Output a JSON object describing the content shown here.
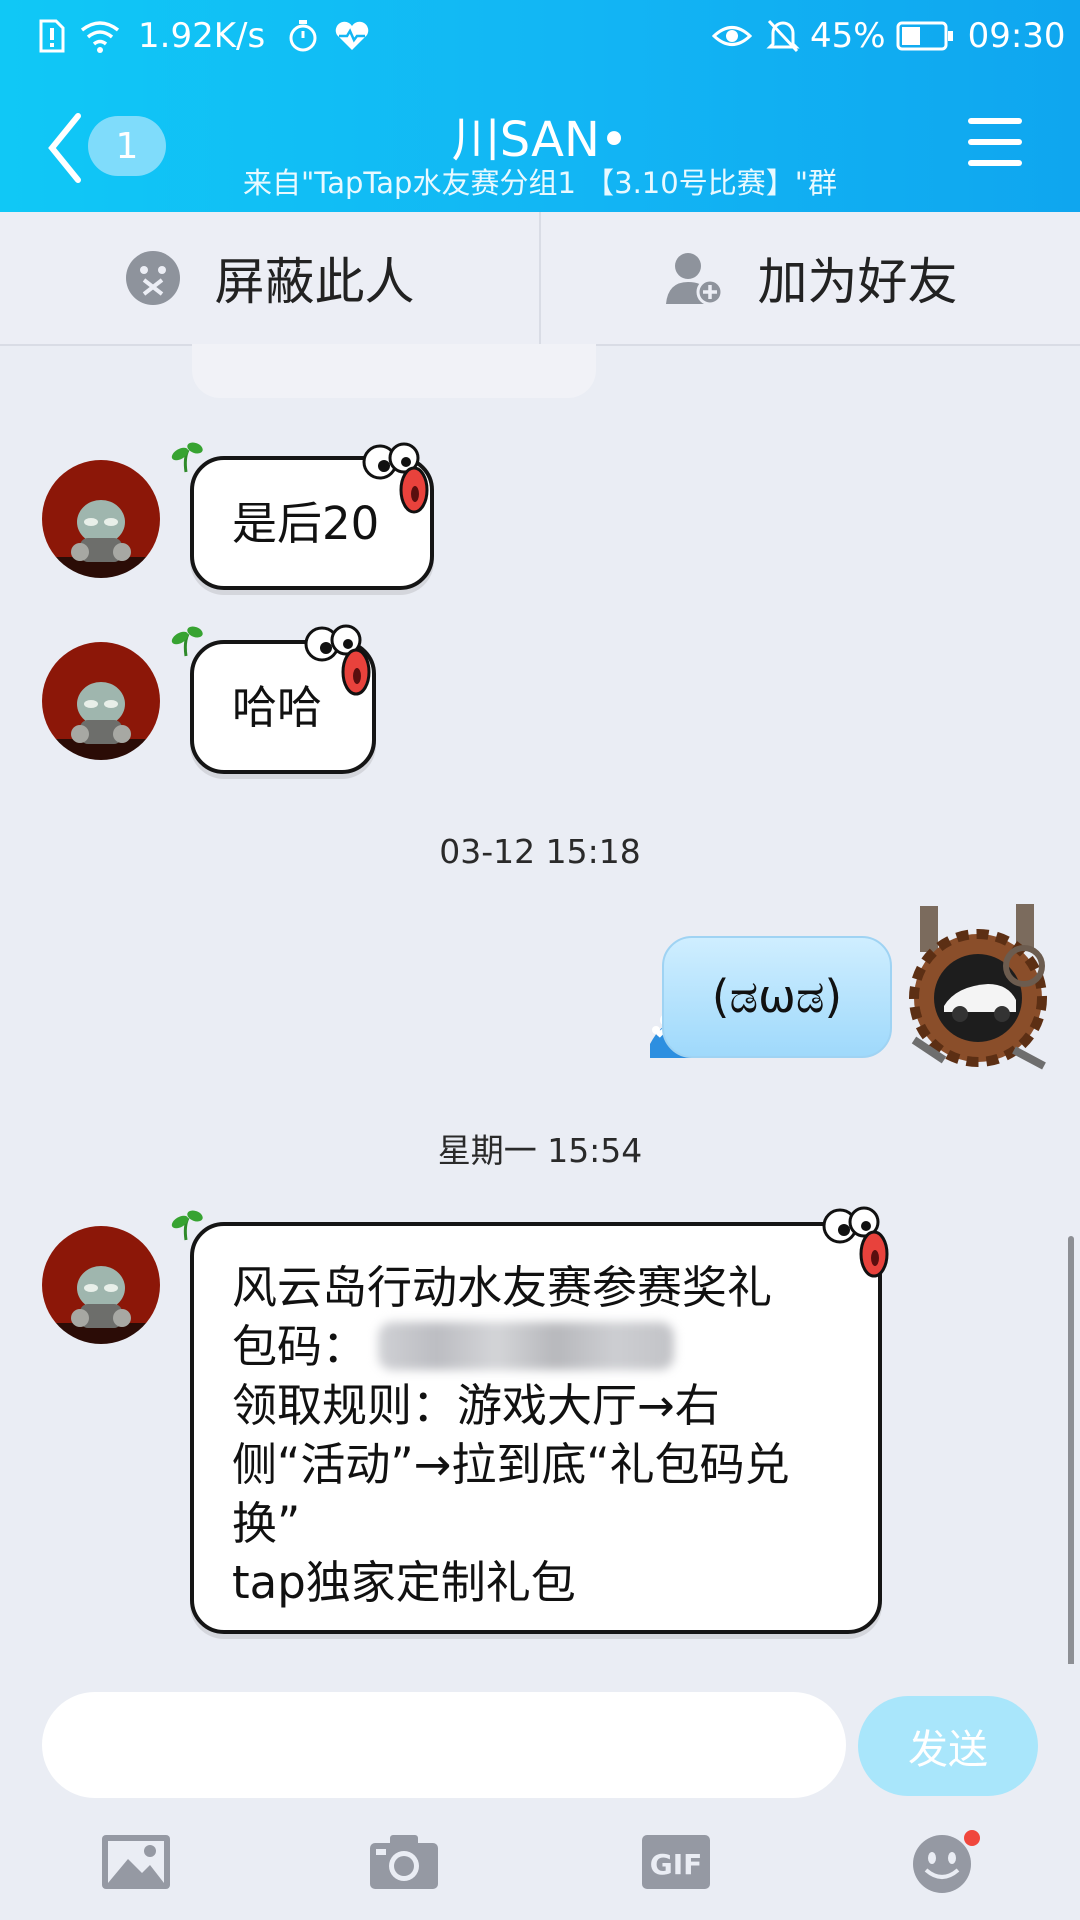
{
  "status_bar": {
    "speed": "1.92K/s",
    "battery": "45%",
    "time": "09:30"
  },
  "header": {
    "back_badge": "1",
    "title": "川SAN•",
    "subtitle": "来自\"TapTap水友赛分组1 【3.10号比赛】\"群"
  },
  "actions": {
    "block_label": "屏蔽此人",
    "add_friend_label": "加为好友"
  },
  "messages": {
    "m1": "是后20",
    "m2": "哈哈",
    "ts1": "03-12 15:18",
    "sent1": "(ಡωಡ)",
    "ts2": "星期一 15:54",
    "m3_lines": {
      "l1": "风云岛行动水友赛参赛奖礼",
      "l2": "包码：",
      "l3": "领取规则：游戏大厅→右",
      "l4": "侧“活动”→拉到底“礼包码兑",
      "l5": "换”",
      "l6": "tap独家定制礼包"
    }
  },
  "composer": {
    "input_value": "",
    "send_label": "发送"
  },
  "colors": {
    "header_gradient_start": "#10c8f6",
    "header_gradient_end": "#0fa6ef",
    "send_button": "#a9e6fb",
    "notification_dot": "#f0473d"
  },
  "icons": [
    "back-chevron-icon",
    "menu-icon",
    "block-face-icon",
    "add-friend-icon",
    "image-icon",
    "camera-icon",
    "gif-icon",
    "emoji-icon"
  ]
}
